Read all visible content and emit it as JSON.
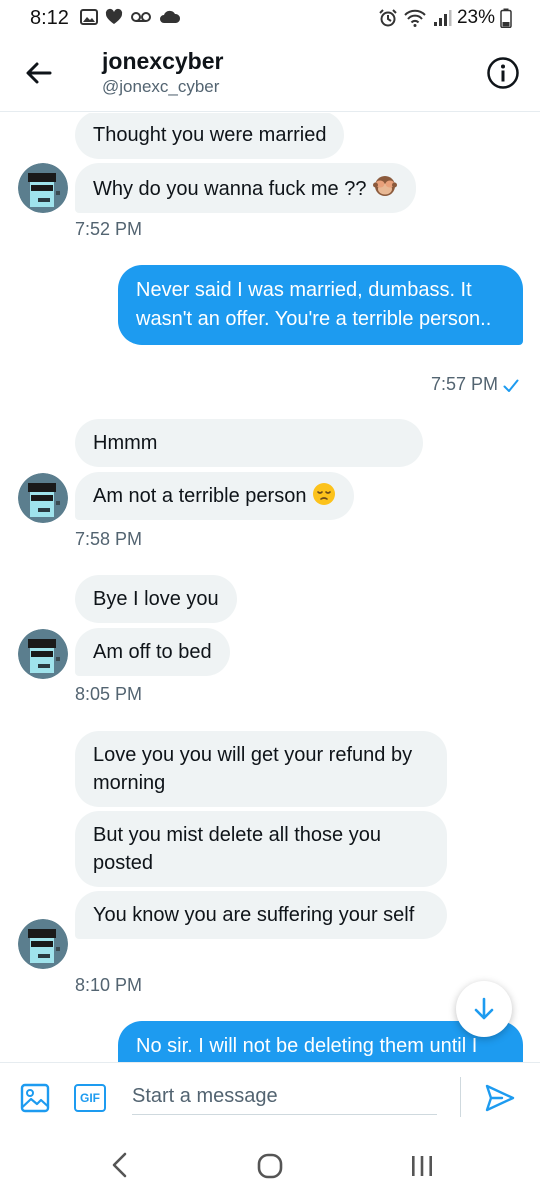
{
  "status_bar": {
    "time": "8:12",
    "battery_percent": "23%",
    "left_icons": [
      "gallery-icon",
      "heart-icon",
      "voicemail-icon",
      "cloud-icon"
    ],
    "right_icons": [
      "alarm-icon",
      "wifi-icon",
      "signal-icon",
      "battery-icon"
    ]
  },
  "header": {
    "display_name": "jonexcyber",
    "handle": "@jonexc_cyber"
  },
  "messages": {
    "m1": "Thought you were married",
    "m2": "Why do you wanna fuck me ??",
    "t1": "7:52 PM",
    "m3": "Never said I was married, dumbass. It wasn't an offer. You're a terrible person..",
    "t2": "7:57 PM",
    "m4": "Hmmm",
    "m5": "Am not a terrible person",
    "t3": "7:58 PM",
    "m6": "Bye I love you",
    "m7": "Am off to bed",
    "t4": "8:05 PM",
    "m8": "Love you you will get your refund by morning",
    "m9": "But you mist delete all those you posted",
    "m10": "You know you are suffering your self",
    "t5": "8:10 PM",
    "m11": "No sir. I will not be deleting them until I"
  },
  "composer": {
    "placeholder": "Start a message",
    "gif_label": "GIF"
  },
  "colors": {
    "accent": "#1d9bf0",
    "incoming_bubble": "#eff3f4",
    "secondary_text": "#536471"
  }
}
